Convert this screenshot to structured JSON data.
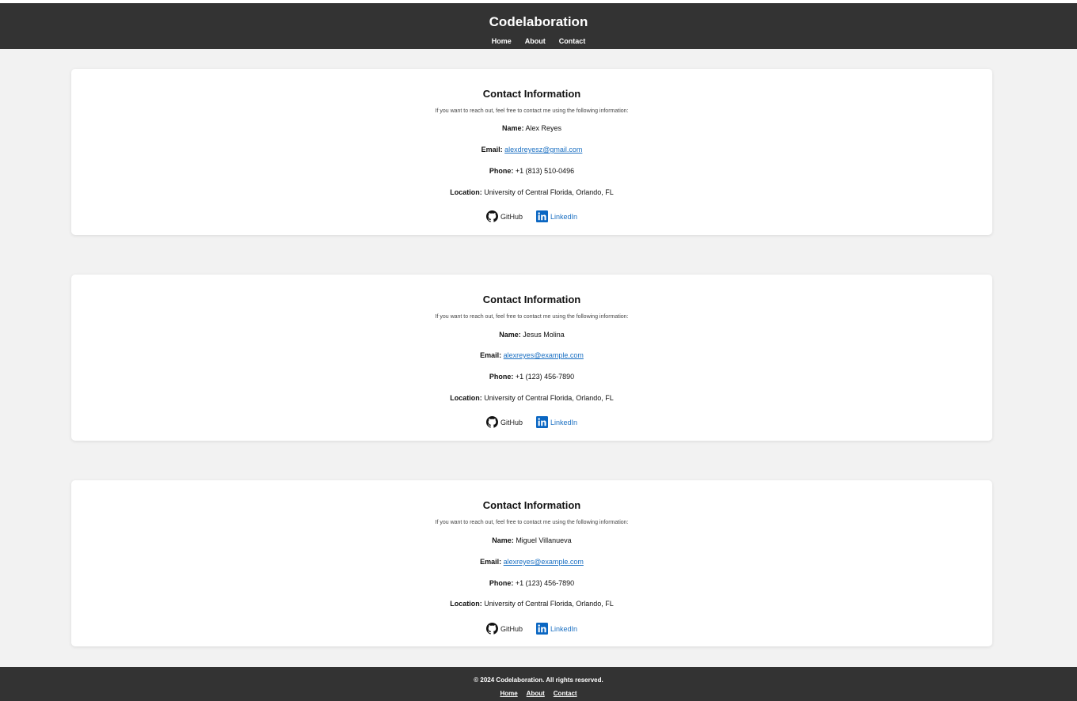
{
  "header": {
    "title": "Codelaboration",
    "nav": [
      "Home",
      "About",
      "Contact"
    ]
  },
  "cards": [
    {
      "heading": "Contact Information",
      "intro": "If you want to reach out, feel free to contact me using the following information:",
      "name_label": "Name:",
      "name": "Alex Reyes",
      "email_label": "Email:",
      "email": "alexdreyesz@gmail.com",
      "phone_label": "Phone:",
      "phone": "+1 (813) 510-0496",
      "location_label": "Location:",
      "location": "University of Central Florida, Orlando, FL",
      "github": "GitHub",
      "linkedin": "LinkedIn"
    },
    {
      "heading": "Contact Information",
      "intro": "If you want to reach out, feel free to contact me using the following information:",
      "name_label": "Name:",
      "name": "Jesus Molina",
      "email_label": "Email:",
      "email": "alexreyes@example.com",
      "phone_label": "Phone:",
      "phone": "+1 (123) 456-7890",
      "location_label": "Location:",
      "location": "University of Central Florida, Orlando, FL",
      "github": "GitHub",
      "linkedin": "LinkedIn"
    },
    {
      "heading": "Contact Information",
      "intro": "If you want to reach out, feel free to contact me using the following information:",
      "name_label": "Name:",
      "name": "Miguel Villanueva",
      "email_label": "Email:",
      "email": "alexreyes@example.com",
      "phone_label": "Phone:",
      "phone": "+1 (123) 456-7890",
      "location_label": "Location:",
      "location": "University of Central Florida, Orlando, FL",
      "github": "GitHub",
      "linkedin": "LinkedIn"
    }
  ],
  "footer": {
    "copyright": "© 2024 Codelaboration. All rights reserved.",
    "nav": [
      "Home",
      "About",
      "Contact"
    ]
  },
  "colors": {
    "header_bg": "#333333",
    "page_bg": "#f2f2f2",
    "link": "#1a6fc2",
    "linkedin_brand": "#0a66c2"
  },
  "icons": {
    "github": "github-icon",
    "linkedin": "linkedin-icon"
  }
}
